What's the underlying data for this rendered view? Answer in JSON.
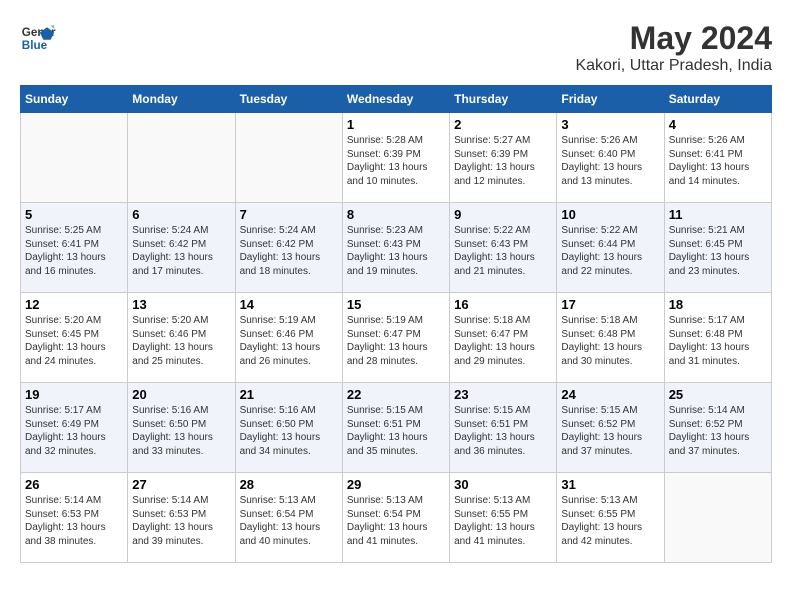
{
  "logo": {
    "line1": "General",
    "line2": "Blue"
  },
  "title": "May 2024",
  "subtitle": "Kakori, Uttar Pradesh, India",
  "days_header": [
    "Sunday",
    "Monday",
    "Tuesday",
    "Wednesday",
    "Thursday",
    "Friday",
    "Saturday"
  ],
  "weeks": [
    [
      {
        "num": "",
        "info": ""
      },
      {
        "num": "",
        "info": ""
      },
      {
        "num": "",
        "info": ""
      },
      {
        "num": "1",
        "info": "Sunrise: 5:28 AM\nSunset: 6:39 PM\nDaylight: 13 hours\nand 10 minutes."
      },
      {
        "num": "2",
        "info": "Sunrise: 5:27 AM\nSunset: 6:39 PM\nDaylight: 13 hours\nand 12 minutes."
      },
      {
        "num": "3",
        "info": "Sunrise: 5:26 AM\nSunset: 6:40 PM\nDaylight: 13 hours\nand 13 minutes."
      },
      {
        "num": "4",
        "info": "Sunrise: 5:26 AM\nSunset: 6:41 PM\nDaylight: 13 hours\nand 14 minutes."
      }
    ],
    [
      {
        "num": "5",
        "info": "Sunrise: 5:25 AM\nSunset: 6:41 PM\nDaylight: 13 hours\nand 16 minutes."
      },
      {
        "num": "6",
        "info": "Sunrise: 5:24 AM\nSunset: 6:42 PM\nDaylight: 13 hours\nand 17 minutes."
      },
      {
        "num": "7",
        "info": "Sunrise: 5:24 AM\nSunset: 6:42 PM\nDaylight: 13 hours\nand 18 minutes."
      },
      {
        "num": "8",
        "info": "Sunrise: 5:23 AM\nSunset: 6:43 PM\nDaylight: 13 hours\nand 19 minutes."
      },
      {
        "num": "9",
        "info": "Sunrise: 5:22 AM\nSunset: 6:43 PM\nDaylight: 13 hours\nand 21 minutes."
      },
      {
        "num": "10",
        "info": "Sunrise: 5:22 AM\nSunset: 6:44 PM\nDaylight: 13 hours\nand 22 minutes."
      },
      {
        "num": "11",
        "info": "Sunrise: 5:21 AM\nSunset: 6:45 PM\nDaylight: 13 hours\nand 23 minutes."
      }
    ],
    [
      {
        "num": "12",
        "info": "Sunrise: 5:20 AM\nSunset: 6:45 PM\nDaylight: 13 hours\nand 24 minutes."
      },
      {
        "num": "13",
        "info": "Sunrise: 5:20 AM\nSunset: 6:46 PM\nDaylight: 13 hours\nand 25 minutes."
      },
      {
        "num": "14",
        "info": "Sunrise: 5:19 AM\nSunset: 6:46 PM\nDaylight: 13 hours\nand 26 minutes."
      },
      {
        "num": "15",
        "info": "Sunrise: 5:19 AM\nSunset: 6:47 PM\nDaylight: 13 hours\nand 28 minutes."
      },
      {
        "num": "16",
        "info": "Sunrise: 5:18 AM\nSunset: 6:47 PM\nDaylight: 13 hours\nand 29 minutes."
      },
      {
        "num": "17",
        "info": "Sunrise: 5:18 AM\nSunset: 6:48 PM\nDaylight: 13 hours\nand 30 minutes."
      },
      {
        "num": "18",
        "info": "Sunrise: 5:17 AM\nSunset: 6:48 PM\nDaylight: 13 hours\nand 31 minutes."
      }
    ],
    [
      {
        "num": "19",
        "info": "Sunrise: 5:17 AM\nSunset: 6:49 PM\nDaylight: 13 hours\nand 32 minutes."
      },
      {
        "num": "20",
        "info": "Sunrise: 5:16 AM\nSunset: 6:50 PM\nDaylight: 13 hours\nand 33 minutes."
      },
      {
        "num": "21",
        "info": "Sunrise: 5:16 AM\nSunset: 6:50 PM\nDaylight: 13 hours\nand 34 minutes."
      },
      {
        "num": "22",
        "info": "Sunrise: 5:15 AM\nSunset: 6:51 PM\nDaylight: 13 hours\nand 35 minutes."
      },
      {
        "num": "23",
        "info": "Sunrise: 5:15 AM\nSunset: 6:51 PM\nDaylight: 13 hours\nand 36 minutes."
      },
      {
        "num": "24",
        "info": "Sunrise: 5:15 AM\nSunset: 6:52 PM\nDaylight: 13 hours\nand 37 minutes."
      },
      {
        "num": "25",
        "info": "Sunrise: 5:14 AM\nSunset: 6:52 PM\nDaylight: 13 hours\nand 37 minutes."
      }
    ],
    [
      {
        "num": "26",
        "info": "Sunrise: 5:14 AM\nSunset: 6:53 PM\nDaylight: 13 hours\nand 38 minutes."
      },
      {
        "num": "27",
        "info": "Sunrise: 5:14 AM\nSunset: 6:53 PM\nDaylight: 13 hours\nand 39 minutes."
      },
      {
        "num": "28",
        "info": "Sunrise: 5:13 AM\nSunset: 6:54 PM\nDaylight: 13 hours\nand 40 minutes."
      },
      {
        "num": "29",
        "info": "Sunrise: 5:13 AM\nSunset: 6:54 PM\nDaylight: 13 hours\nand 41 minutes."
      },
      {
        "num": "30",
        "info": "Sunrise: 5:13 AM\nSunset: 6:55 PM\nDaylight: 13 hours\nand 41 minutes."
      },
      {
        "num": "31",
        "info": "Sunrise: 5:13 AM\nSunset: 6:55 PM\nDaylight: 13 hours\nand 42 minutes."
      },
      {
        "num": "",
        "info": ""
      }
    ]
  ]
}
